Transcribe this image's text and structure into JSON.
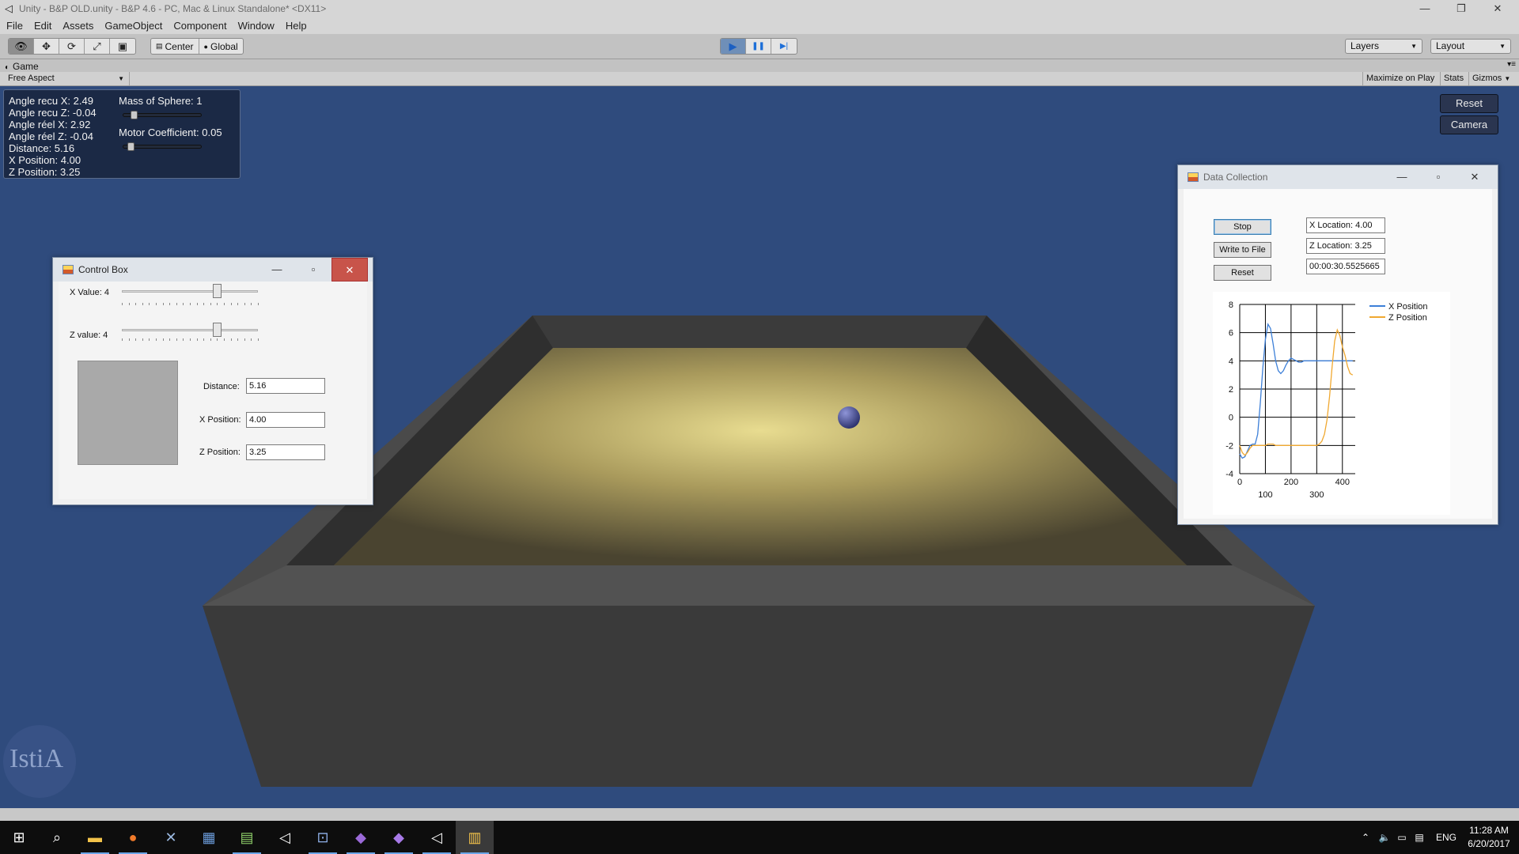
{
  "window": {
    "title": "Unity - B&P OLD.unity - B&P 4.6 - PC, Mac & Linux Standalone* <DX11>",
    "app_icon": "unity-icon",
    "controls": [
      "—",
      "❐",
      "✕"
    ]
  },
  "menu": [
    "File",
    "Edit",
    "Assets",
    "GameObject",
    "Component",
    "Window",
    "Help"
  ],
  "toolbar": {
    "tools": [
      "hand-tool-icon",
      "move-tool-icon",
      "rotate-tool-icon",
      "scale-tool-icon",
      "rect-tool-icon"
    ],
    "pivot_center": "Center",
    "pivot_global": "Global",
    "play": "▶",
    "pause": "❚❚",
    "step": "▶|",
    "layers": "Layers",
    "layout": "Layout"
  },
  "game_view": {
    "tab": "Game",
    "aspect": "Free Aspect",
    "maximize_on_play": "Maximize on Play",
    "stats": "Stats",
    "gizmos": "Gizmos"
  },
  "hud": {
    "stats": [
      "Angle recu X: 2.49",
      "Angle recu Z: -0.04",
      "Angle réel X: 2.92",
      "Angle réel Z: -0.04",
      "Distance: 5.16",
      "X Position:  4.00",
      "Z Position: 3.25"
    ],
    "mass_label": "Mass of Sphere: 1",
    "motor_label": "Motor Coefficient: 0.05",
    "mass_slider_level": 0.1,
    "motor_slider_level": 0.05
  },
  "unity_buttons": {
    "reset": "Reset",
    "camera": "Camera"
  },
  "control_box": {
    "title": "Control Box",
    "x_label": "X Value: 4",
    "z_label": "Z value: 4",
    "x_slider_level": 0.7,
    "z_slider_level": 0.7,
    "distance_label": "Distance:",
    "distance_value": "5.16",
    "xpos_label": "X Position:",
    "xpos_value": "4.00",
    "zpos_label": "Z Position:",
    "zpos_value": "3.25"
  },
  "data_collection": {
    "title": "Data Collection",
    "stop": "Stop",
    "write": "Write to File",
    "reset": "Reset",
    "x_location": "X Location: 4.00",
    "z_location": "Z Location: 3.25",
    "elapsed": "00:00:30.5525665"
  },
  "chart_data": {
    "type": "line",
    "xlim": [
      0,
      450
    ],
    "ylim": [
      -4,
      8
    ],
    "x_ticks_top": [
      "0",
      "200",
      "400"
    ],
    "x_ticks_bottom": [
      "100",
      "300"
    ],
    "y_ticks": [
      "8",
      "6",
      "4",
      "2",
      "0",
      "-2",
      "-4"
    ],
    "grid": true,
    "legend_position": "top-right",
    "series": [
      {
        "name": "X Position",
        "color": "#3c7fd8",
        "x": [
          0,
          10,
          20,
          30,
          40,
          50,
          60,
          70,
          80,
          90,
          100,
          110,
          120,
          130,
          140,
          150,
          160,
          170,
          180,
          190,
          200,
          210,
          220,
          230,
          240,
          250,
          260,
          270,
          280,
          290,
          300,
          310,
          320,
          330,
          340,
          350,
          360,
          370,
          380,
          390,
          400,
          410,
          420,
          430,
          440
        ],
        "y": [
          -2.6,
          -2.9,
          -2.8,
          -2.4,
          -2.0,
          -1.9,
          -1.9,
          -1.2,
          1.0,
          3.5,
          5.5,
          6.6,
          6.3,
          5.2,
          4.0,
          3.3,
          3.1,
          3.3,
          3.7,
          4.0,
          4.2,
          4.1,
          4.0,
          3.9,
          3.9,
          4.0,
          4.0,
          4.0,
          4.0,
          4.0,
          4.0,
          4.0,
          4.0,
          4.0,
          4.0,
          4.0,
          4.0,
          4.0,
          4.0,
          4.0,
          4.0,
          4.0,
          4.0,
          4.0,
          4.0
        ]
      },
      {
        "name": "Z Position",
        "color": "#f0a830",
        "x": [
          0,
          10,
          20,
          30,
          40,
          50,
          60,
          70,
          80,
          90,
          100,
          110,
          120,
          130,
          140,
          150,
          160,
          170,
          180,
          190,
          200,
          210,
          220,
          230,
          240,
          250,
          260,
          270,
          280,
          290,
          300,
          310,
          320,
          330,
          340,
          350,
          360,
          370,
          380,
          390,
          400,
          410,
          420,
          430,
          440
        ],
        "y": [
          -2.0,
          -2.5,
          -2.7,
          -2.5,
          -2.2,
          -2.0,
          -2.0,
          -2.0,
          -2.0,
          -2.0,
          -2.0,
          -1.9,
          -1.9,
          -1.9,
          -2.0,
          -2.0,
          -2.0,
          -2.0,
          -2.0,
          -2.0,
          -2.0,
          -2.0,
          -2.0,
          -2.0,
          -2.0,
          -2.0,
          -2.0,
          -2.0,
          -2.0,
          -2.0,
          -2.0,
          -1.9,
          -1.7,
          -1.2,
          -0.2,
          1.5,
          3.6,
          5.4,
          6.2,
          5.8,
          5.0,
          4.4,
          3.6,
          3.1,
          3.0
        ]
      }
    ]
  },
  "taskbar": {
    "items": [
      "windows-start-icon",
      "search-icon",
      "file-explorer-icon",
      "firefox-icon",
      "xamarin-icon",
      "outlook-icon",
      "notepad-icon",
      "unity-icon",
      "network-app-icon",
      "visual-studio-icon",
      "visual-studio-icon",
      "unity-icon",
      "winform-app-icon"
    ],
    "language": "ENG",
    "time": "11:28 AM",
    "date": "6/20/2017"
  },
  "logo": {
    "text": "IstiA"
  }
}
